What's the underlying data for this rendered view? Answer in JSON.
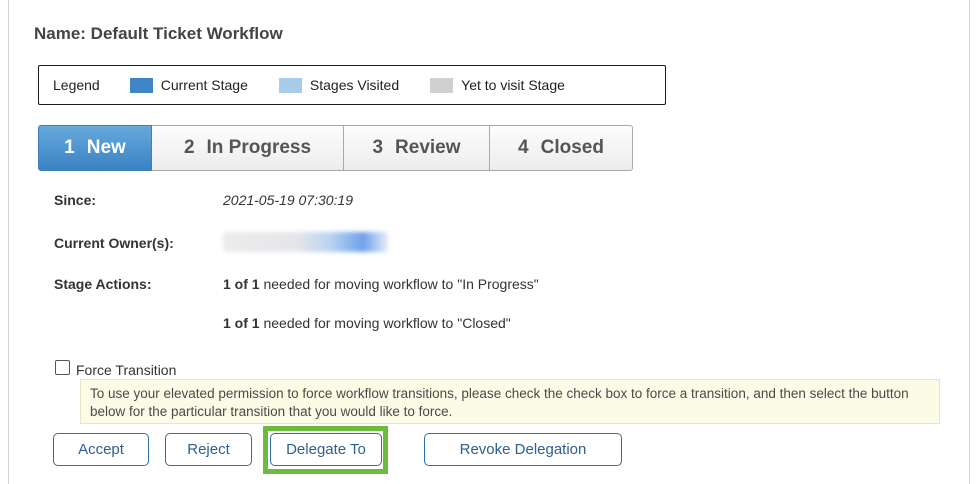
{
  "workflow": {
    "name": "Name: Default Ticket Workflow"
  },
  "legend": {
    "title": "Legend",
    "items": [
      {
        "label": "Current Stage",
        "color": "#3f86c6"
      },
      {
        "label": "Stages Visited",
        "color": "#a9cde8"
      },
      {
        "label": "Yet to visit Stage",
        "color": "#d0d0d0"
      }
    ]
  },
  "stages": [
    {
      "num": "1",
      "label": "New",
      "status": "current"
    },
    {
      "num": "2",
      "label": "In Progress",
      "status": "pending"
    },
    {
      "num": "3",
      "label": "Review",
      "status": "pending"
    },
    {
      "num": "4",
      "label": "Closed",
      "status": "pending"
    }
  ],
  "info": {
    "since_label": "Since:",
    "since_value": "2021-05-19 07:30:19",
    "owner_label": "Current Owner(s):",
    "actions_label": "Stage Actions:",
    "actions": [
      {
        "count": "1 of 1",
        "text": " needed for moving workflow to \"In Progress\""
      },
      {
        "count": "1 of 1",
        "text": " needed for moving workflow to \"Closed\""
      }
    ]
  },
  "force": {
    "label": "Force Transition",
    "checked": false,
    "note": "To use your elevated permission to force workflow transitions, please check the check box to force a transition, and then select the button below for the particular transition that you would like to force."
  },
  "buttons": {
    "accept": "Accept",
    "reject": "Reject",
    "delegate": "Delegate To",
    "revoke": "Revoke Delegation"
  },
  "colors": {
    "highlight": "#6dbb3c",
    "button_border": "#2d6fa8"
  }
}
